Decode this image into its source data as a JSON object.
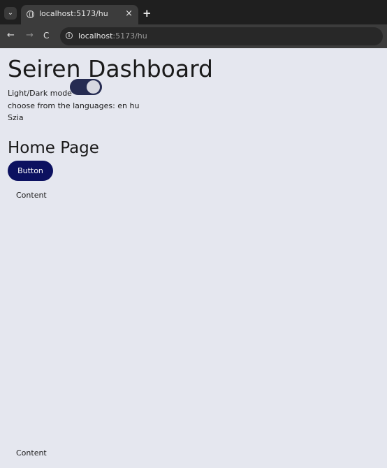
{
  "browser": {
    "tab_title": "localhost:5173/hu",
    "tab_close": "×",
    "new_tab": "+",
    "url_host": "localhost",
    "url_path": ":5173/hu",
    "nav": {
      "back": "←",
      "forward": "→",
      "reload": "C"
    },
    "tab_menu": "⌄",
    "info_glyph": "i"
  },
  "header": {
    "title": "Seiren Dashboard",
    "mode_label": "Light/Dark mode",
    "dark_mode_on": true
  },
  "languages": {
    "prompt": "choose from the languages:",
    "options": [
      "en",
      "hu"
    ]
  },
  "greeting": "Szia",
  "home": {
    "title": "Home Page",
    "button_label": "Button",
    "content_top": "Content",
    "content_bottom": "Content"
  },
  "colors": {
    "background": "#e5e7ef",
    "button": "#0c1160",
    "toggle": "#262c52"
  }
}
